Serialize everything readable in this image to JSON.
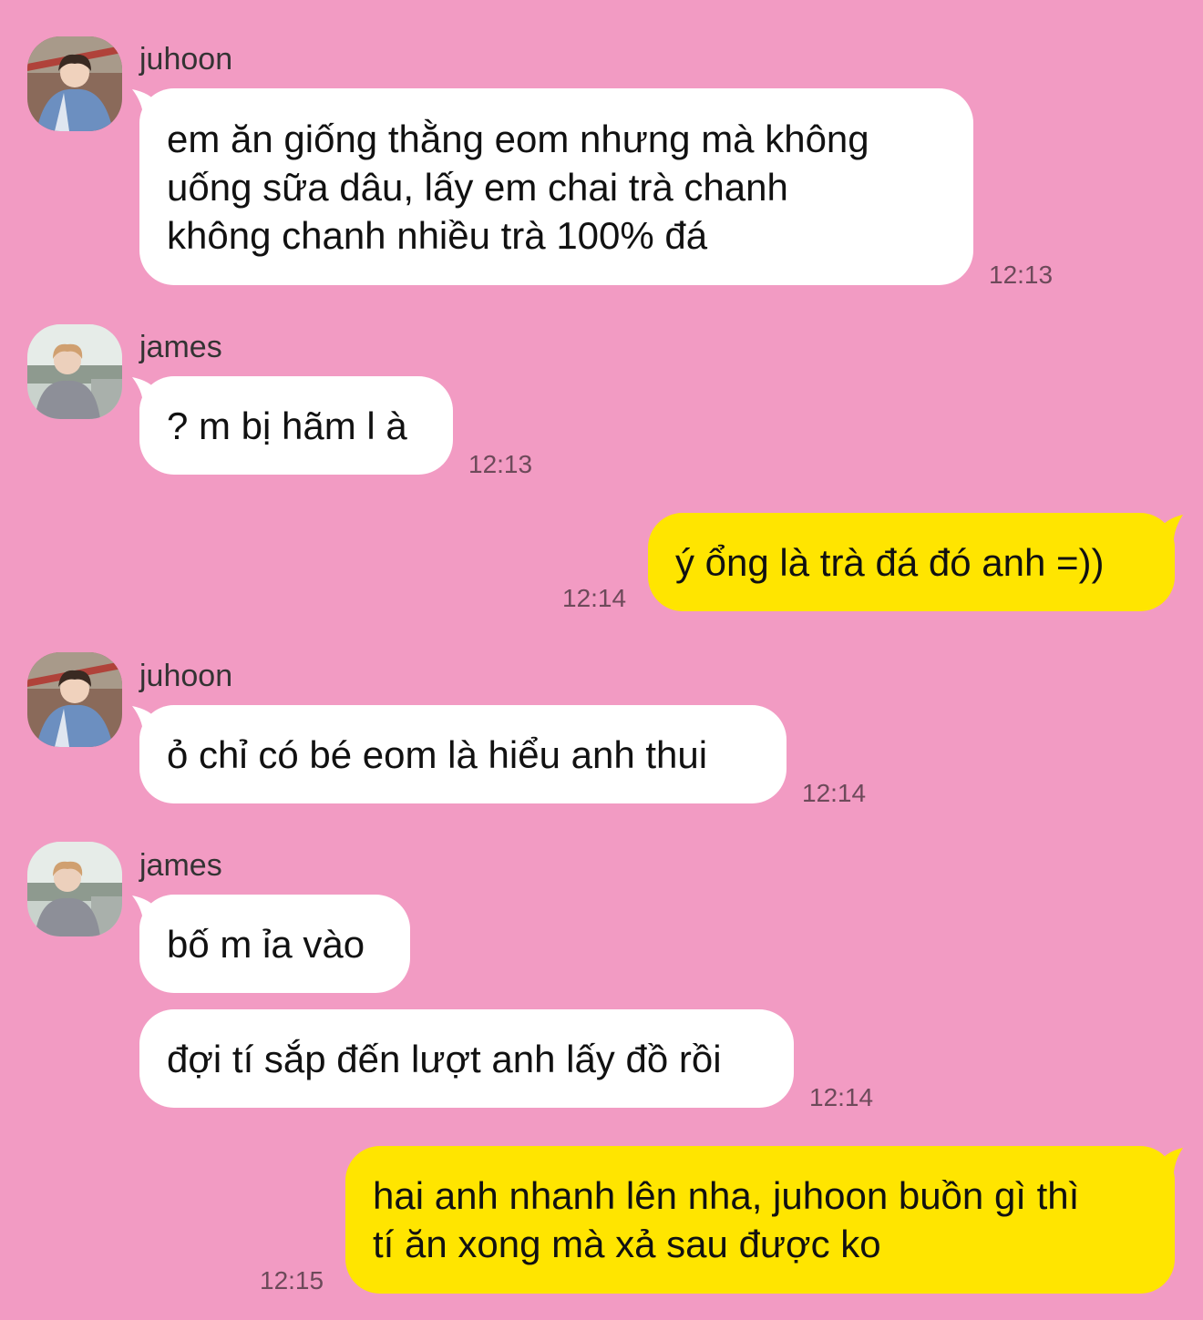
{
  "colors": {
    "background": "#f29bc3",
    "incoming_bubble": "#ffffff",
    "outgoing_bubble": "#ffe500",
    "timestamp": "#6d4a5a"
  },
  "messages": [
    {
      "sender": "juhoon",
      "avatar": "juhoon-avatar",
      "lines": [
        "em ăn giống thằng eom nhưng mà không",
        "uống sữa dâu, lấy em chai trà chanh",
        "không chanh nhiều trà 100% đá"
      ],
      "time": "12:13"
    },
    {
      "sender": "james",
      "avatar": "james-avatar",
      "lines": [
        "? m bị hãm l à"
      ],
      "time": "12:13"
    },
    {
      "sender": "me",
      "lines": [
        "ý ổng là trà đá đó anh =))"
      ],
      "time": "12:14"
    },
    {
      "sender": "juhoon",
      "avatar": "juhoon-avatar",
      "lines": [
        "ỏ chỉ có bé eom là hiểu anh thui"
      ],
      "time": "12:14"
    },
    {
      "sender": "james",
      "avatar": "james-avatar",
      "lines": [
        "bố m ỉa vào"
      ],
      "time": ""
    },
    {
      "sender": "james",
      "lines": [
        "đợi tí sắp đến lượt anh lấy đồ rồi"
      ],
      "time": "12:14"
    },
    {
      "sender": "me",
      "lines": [
        "hai anh nhanh lên nha, juhoon buồn gì thì",
        "tí ăn xong mà xả sau được ko"
      ],
      "time": "12:15"
    }
  ]
}
